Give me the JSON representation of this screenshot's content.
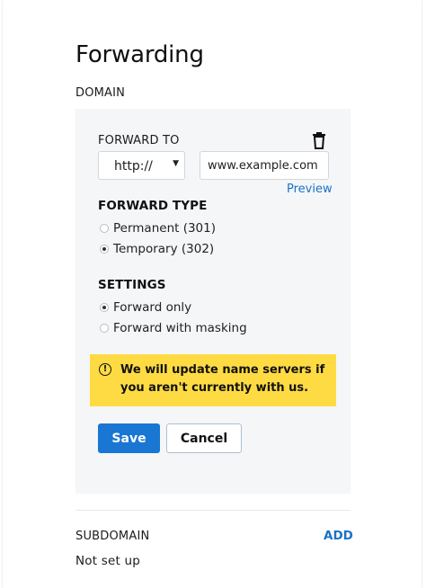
{
  "page": {
    "title": "Forwarding"
  },
  "domain": {
    "section_label": "DOMAIN",
    "forward_to_label": "FORWARD TO",
    "trash_icon": "trash-icon",
    "protocol": {
      "selected": "http://"
    },
    "url_input": {
      "value": "www.example.com"
    },
    "preview_label": "Preview",
    "forward_type": {
      "heading": "FORWARD TYPE",
      "options": [
        {
          "label": "Permanent (301)",
          "checked": false
        },
        {
          "label": "Temporary (302)",
          "checked": true
        }
      ]
    },
    "settings": {
      "heading": "SETTINGS",
      "options": [
        {
          "label": "Forward only",
          "checked": true
        },
        {
          "label": "Forward with masking",
          "checked": false
        }
      ]
    },
    "notice": {
      "icon": "info-icon",
      "text": "We will update name servers if you aren't currently with us.",
      "color": "#ffdb43"
    },
    "buttons": {
      "save_label": "Save",
      "cancel_label": "Cancel"
    }
  },
  "subdomain": {
    "section_label": "SUBDOMAIN",
    "add_label": "ADD",
    "status": "Not set up"
  },
  "colors": {
    "accent": "#1976d2",
    "link": "#1a73c7",
    "panel_background": "#f5f6f8"
  }
}
